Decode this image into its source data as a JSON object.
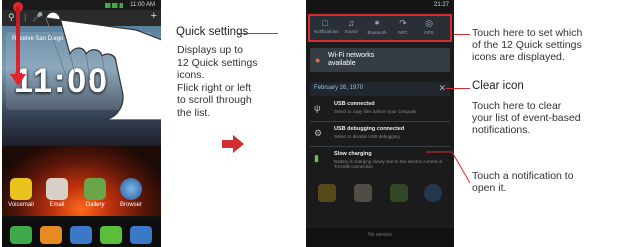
{
  "left_phone": {
    "status_time": "11:00 AM",
    "city": "Receive San Diego",
    "clock": "11:00",
    "apps": [
      "Voicemail",
      "Email",
      "Gallery",
      "Browser"
    ]
  },
  "quick_settings_callout": {
    "title": "Quick settings",
    "desc": [
      "Displays up to",
      "12 Quick settings",
      "icons.",
      "Flick right or left",
      "to scroll through",
      "the list."
    ]
  },
  "right_phone": {
    "status_time": "21:27",
    "qs_items": [
      "Notifications",
      "Sound",
      "Bluetooth",
      "NFC",
      "GPS"
    ],
    "wifi_line1": "Wi-Fi networks",
    "wifi_line2": "available",
    "date": "February 26, 1970",
    "notifications": [
      {
        "title": "USB connected",
        "sub": "Select to copy files to/from your computer"
      },
      {
        "title": "USB debugging connected",
        "sub": "Select to disable USB debugging."
      },
      {
        "title": "Slow charging",
        "sub": "Battery is charging slowly due to low electric current of TA/USB connection"
      }
    ],
    "bottom": "No service"
  },
  "right_annotations": {
    "set_icons": [
      "Touch here to set which",
      "of the 12 Quick settings",
      "icons are displayed."
    ],
    "clear_icon_title": "Clear icon",
    "clear_icon_desc": [
      "Touch here to clear",
      "your list of event-based",
      "notifications."
    ],
    "touch_notification": [
      "Touch a notification to",
      "open it."
    ]
  },
  "colors": {
    "accent_red": "#d32d34"
  }
}
